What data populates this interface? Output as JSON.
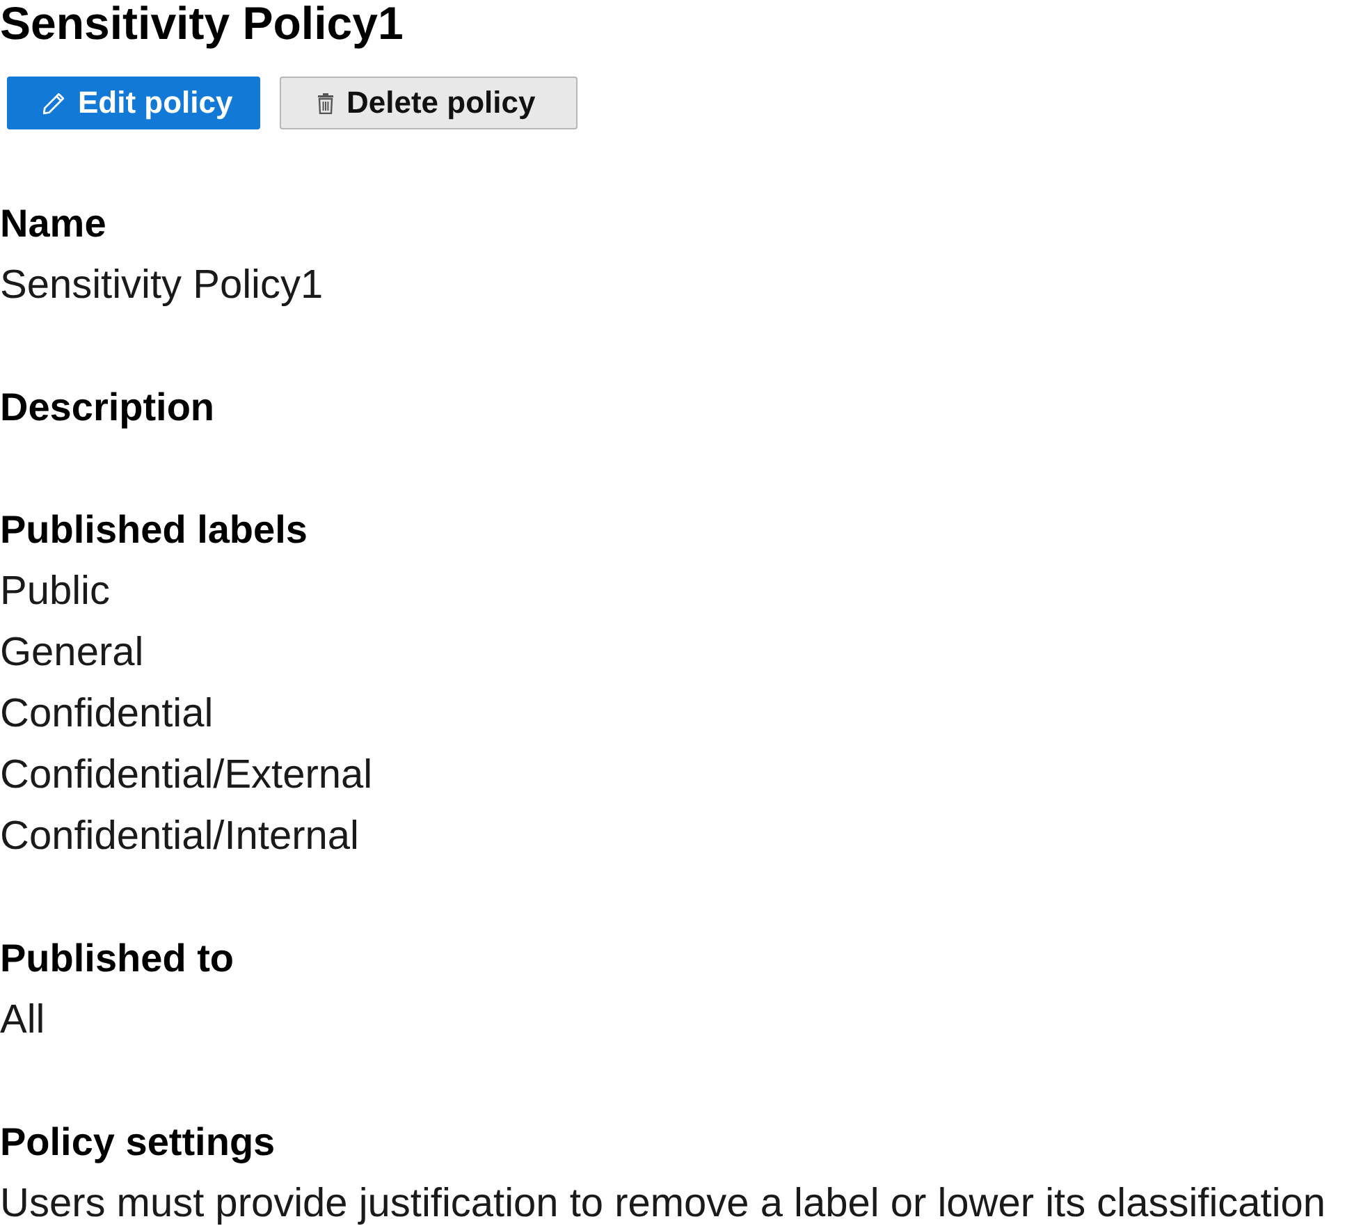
{
  "title": "Sensitivity Policy1",
  "actions": [
    {
      "kind": "primary",
      "label": "Edit policy"
    },
    {
      "kind": "secondary",
      "label": "Delete policy"
    }
  ],
  "sections": [
    {
      "heading": "Name",
      "values": [
        "Sensitivity Policy1"
      ]
    },
    {
      "heading": "Description"
    },
    {
      "heading": "Published labels",
      "values": [
        "Public",
        "General",
        "Confidential",
        "Confidential/External",
        "Confidential/Internal"
      ]
    },
    {
      "heading": "Published to",
      "values": [
        "All"
      ]
    },
    {
      "heading": "Policy settings",
      "values": [
        "Users must provide justification to remove a label or lower its classification"
      ]
    }
  ]
}
